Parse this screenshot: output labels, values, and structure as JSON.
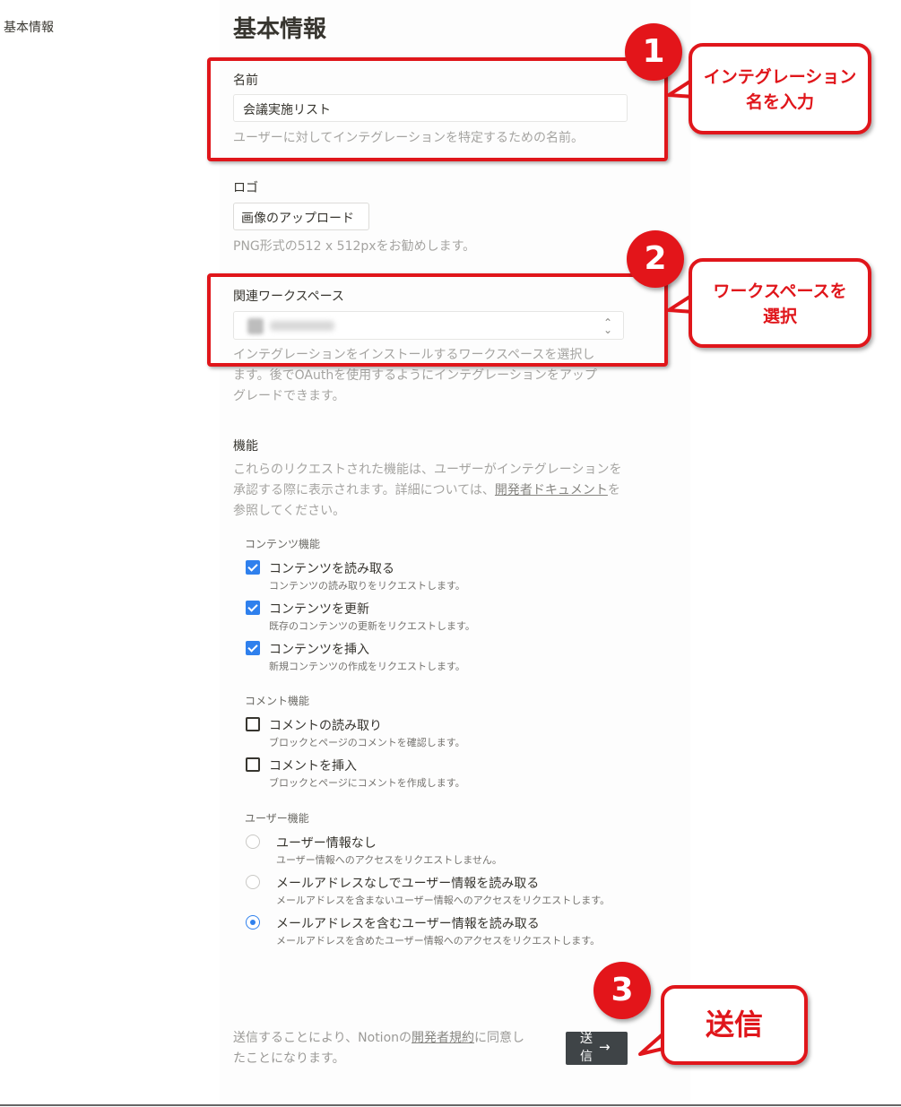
{
  "sidebar": {
    "item": "基本情報"
  },
  "page": {
    "title": "基本情報"
  },
  "name_field": {
    "label": "名前",
    "value": "会議実施リスト",
    "hint": "ユーザーに対してインテグレーションを特定するための名前。"
  },
  "logo": {
    "label": "ロゴ",
    "button": "画像のアップロード",
    "hint": "PNG形式の512 x 512pxをお勧めします。"
  },
  "workspace": {
    "label": "関連ワークスペース",
    "hint_line1": "インテグレーションをインストールするワークスペースを選択し",
    "hint_line2": "ます。後でOAuthを使用するようにインテグレーションをアップ",
    "hint_line3": "グレードできます。"
  },
  "capabilities": {
    "label": "機能",
    "desc_line1": "これらのリクエストされた機能は、ユーザーがインテグレーションを",
    "desc_line2_pre": "承認する際に表示されます。詳細については、",
    "desc_link": "開発者ドキュメント",
    "desc_line2_post": "を",
    "desc_line3": "参照してください。",
    "content_group": "コンテンツ機能",
    "content_options": [
      {
        "title": "コンテンツを読み取る",
        "desc": "コンテンツの読み取りをリクエストします。",
        "checked": true
      },
      {
        "title": "コンテンツを更新",
        "desc": "既存のコンテンツの更新をリクエストします。",
        "checked": true
      },
      {
        "title": "コンテンツを挿入",
        "desc": "新規コンテンツの作成をリクエストします。",
        "checked": true
      }
    ],
    "comment_group": "コメント機能",
    "comment_options": [
      {
        "title": "コメントの読み取り",
        "desc": "ブロックとページのコメントを確認します。",
        "checked": false
      },
      {
        "title": "コメントを挿入",
        "desc": "ブロックとページにコメントを作成します。",
        "checked": false
      }
    ],
    "user_group": "ユーザー機能",
    "user_options": [
      {
        "title": "ユーザー情報なし",
        "desc": "ユーザー情報へのアクセスをリクエストしません。",
        "selected": false
      },
      {
        "title": "メールアドレスなしでユーザー情報を読み取る",
        "desc": "メールアドレスを含まないユーザー情報へのアクセスをリクエストします。",
        "selected": false
      },
      {
        "title": "メールアドレスを含むユーザー情報を読み取る",
        "desc": "メールアドレスを含めたユーザー情報へのアクセスをリクエストします。",
        "selected": true
      }
    ]
  },
  "footer": {
    "note_pre": "送信することにより、Notionの",
    "note_link": "開発者規約",
    "note_post": "に同意したことになります。",
    "submit": "送信",
    "submit_arrow": "→"
  },
  "annotations": {
    "step1": {
      "number": "1",
      "line1": "インテグレーション",
      "line2": "名を入力"
    },
    "step2": {
      "number": "2",
      "line1": "ワークスペースを",
      "line2": "選択"
    },
    "step3": {
      "number": "3",
      "text": "送信"
    },
    "color": "#e0161b"
  }
}
